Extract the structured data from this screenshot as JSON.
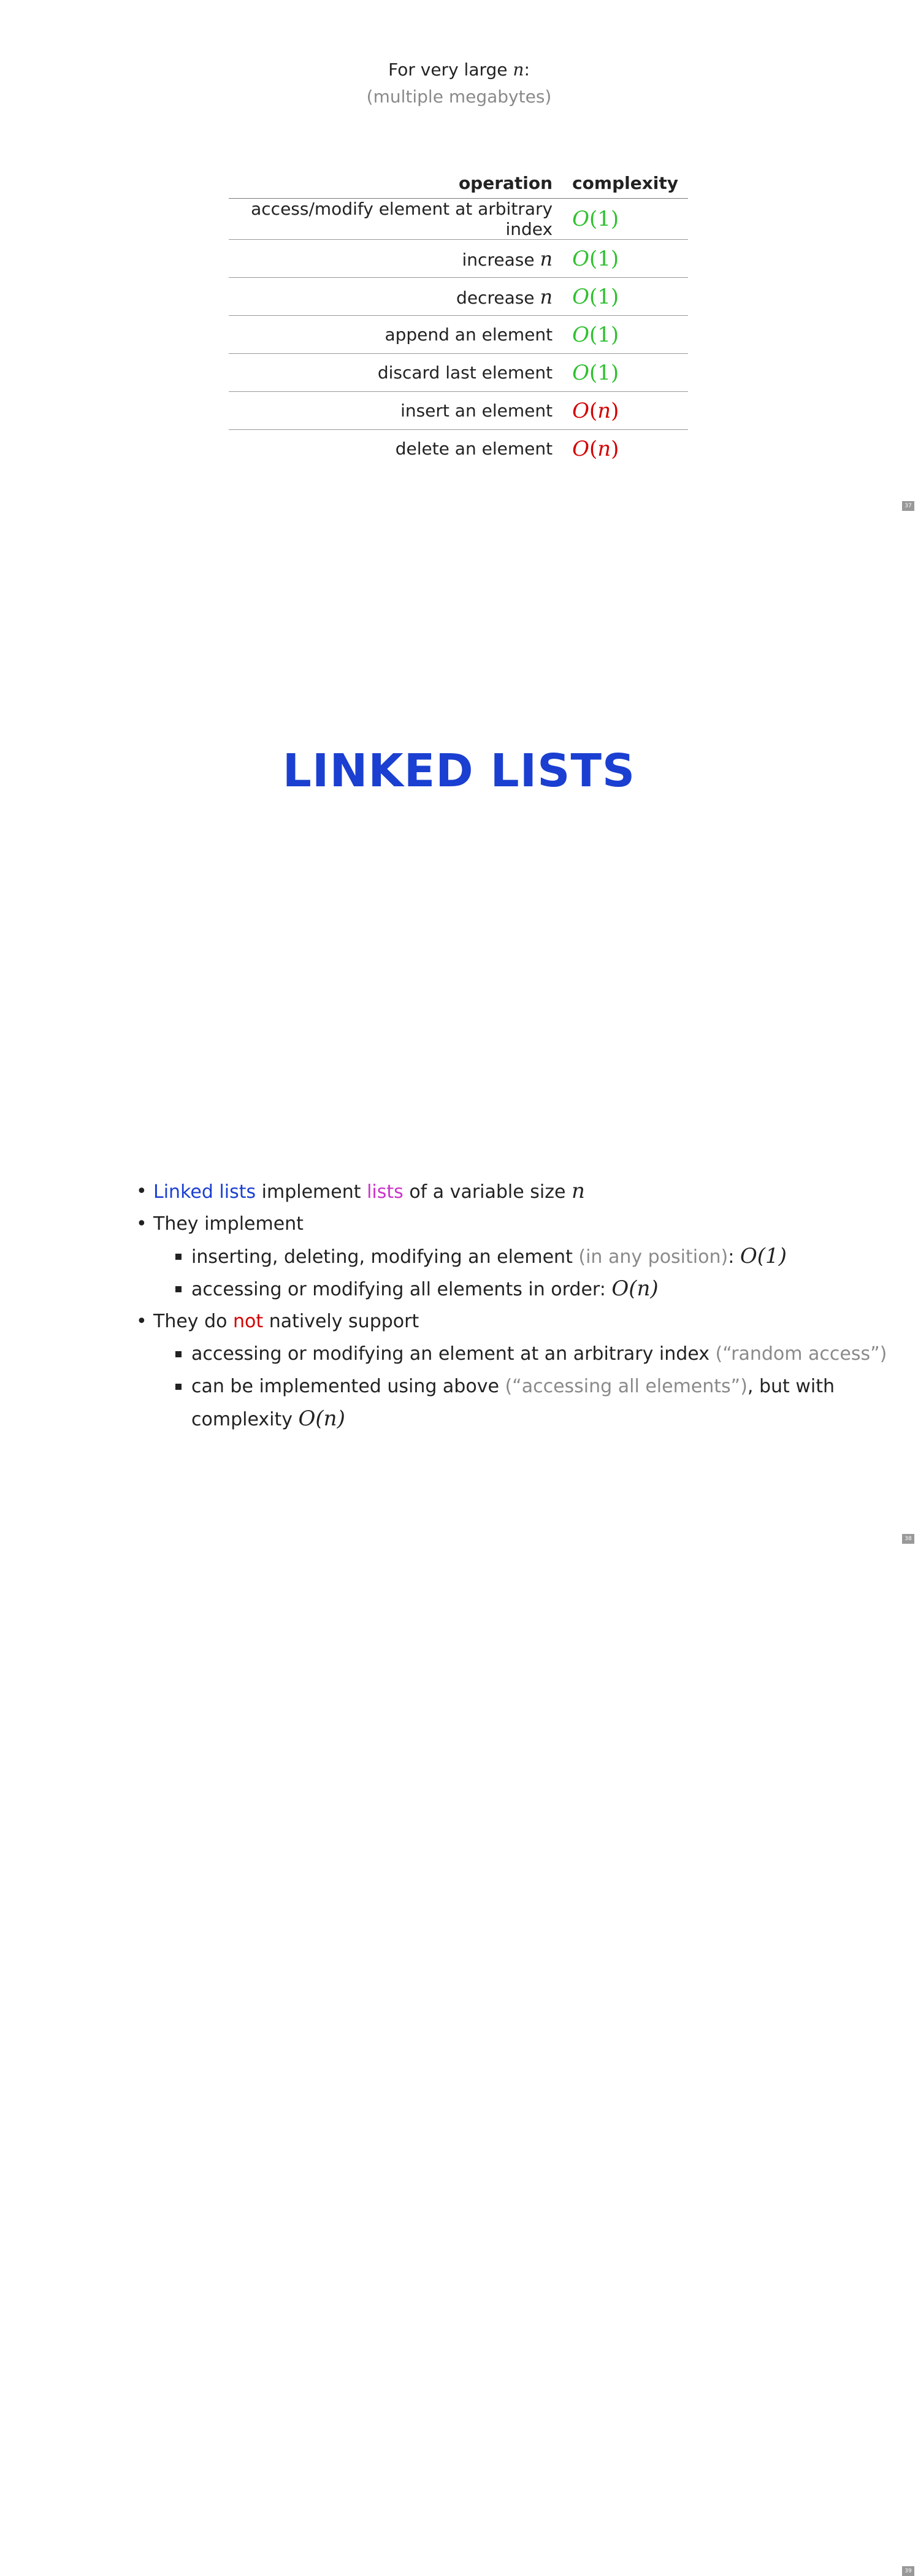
{
  "slide37": {
    "intro_line1": "For very large",
    "intro_var": "n",
    "intro_colon": ":",
    "intro_line2": "(multiple megabytes)",
    "table": {
      "header_operation": "operation",
      "header_complexity": "complexity",
      "rows": [
        {
          "op": "access/modify element at arbitrary index",
          "op_var": "",
          "cx_o": "O",
          "cx_arg": "1",
          "color": "#2fc02f"
        },
        {
          "op": "increase",
          "op_var": "n",
          "cx_o": "O",
          "cx_arg": "1",
          "color": "#2fc02f"
        },
        {
          "op": "decrease",
          "op_var": "n",
          "cx_o": "O",
          "cx_arg": "1",
          "color": "#2fc02f"
        },
        {
          "op": "append an element",
          "op_var": "",
          "cx_o": "O",
          "cx_arg": "1",
          "color": "#2fc02f"
        },
        {
          "op": "discard last element",
          "op_var": "",
          "cx_o": "O",
          "cx_arg": "1",
          "color": "#2fc02f"
        },
        {
          "op": "insert an element",
          "op_var": "",
          "cx_o": "O",
          "cx_arg": "n",
          "color": "#d40000"
        },
        {
          "op": "delete an element",
          "op_var": "",
          "cx_o": "O",
          "cx_arg": "n",
          "color": "#d40000"
        }
      ]
    },
    "page_number": "37"
  },
  "slide38": {
    "title": "LINKED LISTS",
    "page_number": "38"
  },
  "slide39": {
    "b1_part1": "Linked lists",
    "b1_part2": "implement",
    "b1_part3": "lists",
    "b1_part4": "of a variable size",
    "b1_var": "n",
    "b2": "They implement",
    "b2_1_text": "inserting, deleting, modifying an element",
    "b2_1_gray": "(in any position)",
    "b2_1_colon": ":",
    "b2_1_math": "O(1)",
    "b2_2_text": "accessing or modifying all elements in order:",
    "b2_2_math": "O(n)",
    "b3_part1": "They do",
    "b3_not": "not",
    "b3_part2": "natively support",
    "b3_1_text": "accessing or modifying an element at an arbitrary index",
    "b3_1_gray": "(“random access”)",
    "b3_2_text": "can be implemented using above",
    "b3_2_gray": "(“accessing all elements”)",
    "b3_2_text2": ", but with complexity",
    "b3_2_math": "O(n)",
    "page_number": "39"
  },
  "colors": {
    "green": "#2fc02f",
    "red": "#d40000",
    "blue": "#1a3fd1",
    "magenta": "#cc33cc",
    "gray": "#8a8a8a"
  }
}
